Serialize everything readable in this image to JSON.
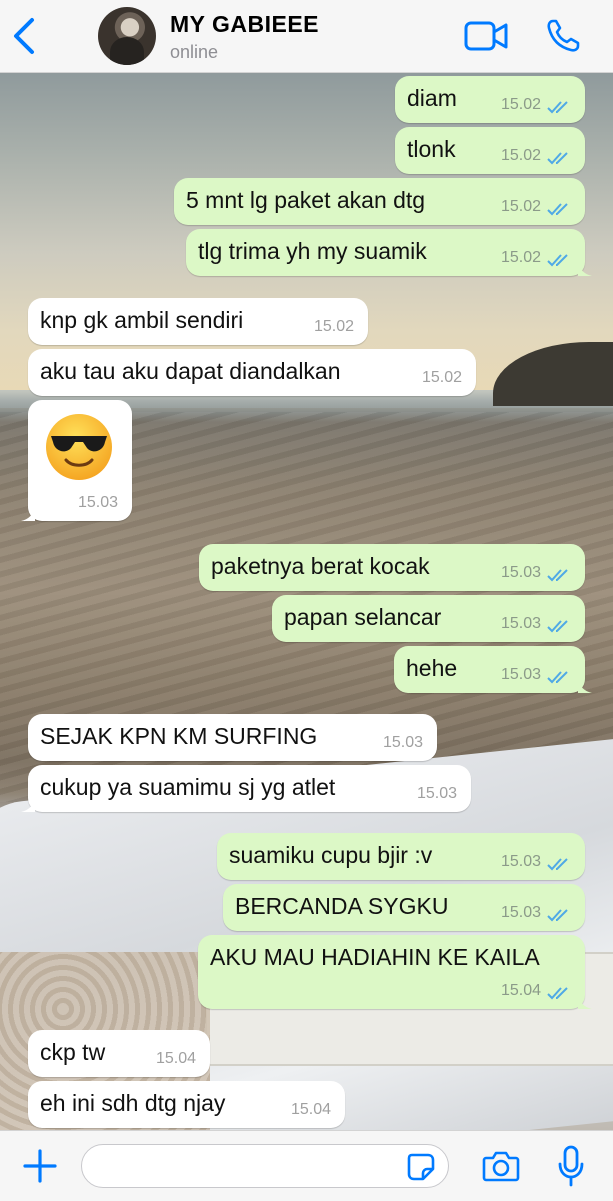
{
  "colors": {
    "accent": "#007aff",
    "outgoing_bubble": "#dcf8c6",
    "incoming_bubble": "#ffffff",
    "read_ticks": "#4fa9e6",
    "header_bg": "#f6f6f6"
  },
  "header": {
    "back_icon": "chevron-left-icon",
    "contact_name": "MY GABIEEE",
    "status": "online",
    "video_icon": "video-camera-icon",
    "call_icon": "phone-icon"
  },
  "messages": [
    {
      "direction": "out",
      "text": "diam",
      "time": "15.02",
      "status": "read"
    },
    {
      "direction": "out",
      "text": "tlonk",
      "time": "15.02",
      "status": "read"
    },
    {
      "direction": "out",
      "text": "5 mnt lg paket akan dtg",
      "time": "15.02",
      "status": "read"
    },
    {
      "direction": "out",
      "text": "tlg trima yh my suamik",
      "time": "15.02",
      "status": "read"
    },
    {
      "direction": "in",
      "text": "knp gk ambil sendiri",
      "time": "15.02"
    },
    {
      "direction": "in",
      "text": "aku tau aku dapat diandalkan",
      "time": "15.02"
    },
    {
      "direction": "in",
      "emoji": "smiling-face-with-sunglasses",
      "time": "15.03"
    },
    {
      "direction": "out",
      "text": "paketnya berat kocak",
      "time": "15.03",
      "status": "read"
    },
    {
      "direction": "out",
      "text": "papan selancar",
      "time": "15.03",
      "status": "read"
    },
    {
      "direction": "out",
      "text": "hehe",
      "time": "15.03",
      "status": "read"
    },
    {
      "direction": "in",
      "text": "SEJAK KPN KM SURFING",
      "time": "15.03"
    },
    {
      "direction": "in",
      "text": "cukup ya suamimu sj yg atlet",
      "time": "15.03"
    },
    {
      "direction": "out",
      "text": "suamiku cupu bjir :v",
      "time": "15.03",
      "status": "read"
    },
    {
      "direction": "out",
      "text": "BERCANDA SYGKU",
      "time": "15.03",
      "status": "read"
    },
    {
      "direction": "out",
      "text": "AKU MAU HADIAHIN KE KAILA",
      "time": "15.04",
      "status": "read"
    },
    {
      "direction": "in",
      "text": "ckp tw",
      "time": "15.04"
    },
    {
      "direction": "in",
      "text": "eh ini sdh dtg njay",
      "time": "15.04"
    }
  ],
  "input_bar": {
    "plus_icon": "plus-icon",
    "placeholder": "",
    "value": "",
    "sticker_icon": "sticker-icon",
    "camera_icon": "camera-icon",
    "mic_icon": "microphone-icon"
  }
}
